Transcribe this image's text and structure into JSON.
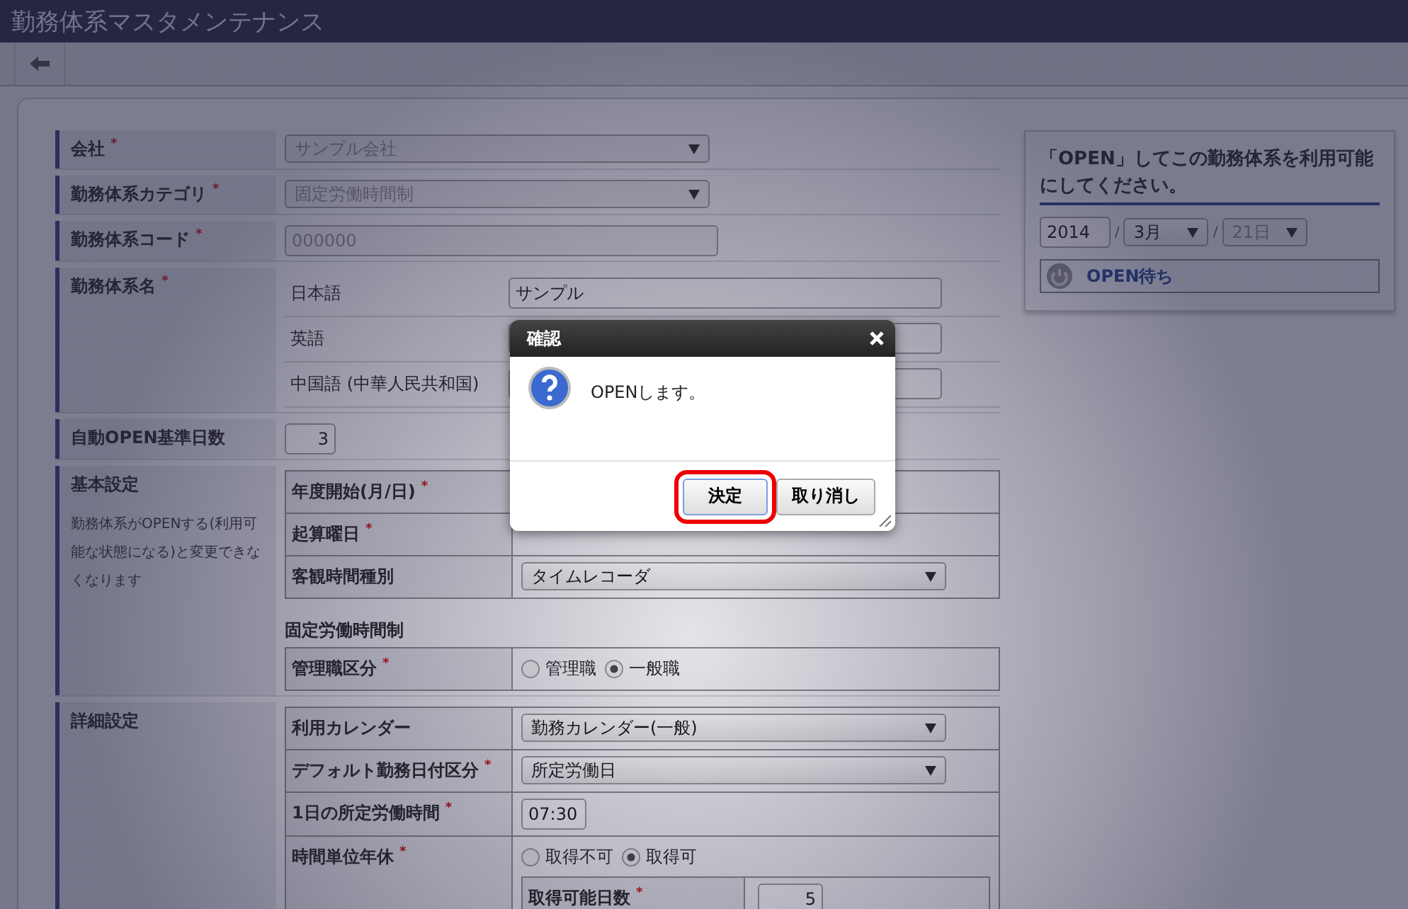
{
  "window": {
    "title": "勤務体系マスタメンテナンス"
  },
  "form": {
    "rows": [
      {
        "kind": "select",
        "label": "会社",
        "mark": "*",
        "value": "サンプル会社",
        "disabled": true
      },
      {
        "kind": "select",
        "label": "勤務体系カテゴリ",
        "mark": "*",
        "value": "固定労働時間制",
        "disabled": true
      },
      {
        "kind": "input",
        "label": "勤務体系コード",
        "mark": "*",
        "value": "000000",
        "disabled": true
      },
      {
        "kind": "names",
        "label": "勤務体系名",
        "mark": "*",
        "names": [
          {
            "language": "日本語",
            "value": "サンプル"
          },
          {
            "language": "英語"
          },
          {
            "language": "中国語 (中華人民共和国)"
          }
        ]
      },
      {
        "kind": "number",
        "label": "自動OPEN基準日数",
        "value": "3",
        "disabled": false
      },
      {
        "kind": "section",
        "label": "基本設定",
        "note": "勤務体系がOPENする(利用可能な状態になる)と変更できなくなります",
        "groups": [
          {
            "fields": [
              {
                "kind": "blank",
                "label": "年度開始(月/日)",
                "mark": "*"
              },
              {
                "kind": "blank",
                "label": "起算曜日",
                "mark": "*"
              },
              {
                "kind": "select",
                "label": "客観時間種別",
                "value": "タイムレコーダ",
                "disabled": false
              }
            ]
          },
          {
            "heading": "固定労働時間制",
            "fields": [
              {
                "kind": "radio",
                "label": "管理職区分",
                "mark": "*",
                "options": [
                  {
                    "label": "管理職",
                    "selected": false
                  },
                  {
                    "label": "一般職",
                    "selected": true
                  }
                ]
              }
            ]
          }
        ]
      },
      {
        "kind": "section",
        "label": "詳細設定",
        "groups": [
          {
            "fields": [
              {
                "kind": "select",
                "label": "利用カレンダー",
                "value": "勤務カレンダー(一般)",
                "disabled": false
              },
              {
                "kind": "select",
                "label": "デフォルト勤務日付区分",
                "mark": "*",
                "value": "所定労働日",
                "disabled": false
              },
              {
                "kind": "input",
                "label": "1日の所定労働時間",
                "mark": "*",
                "value": "07:30",
                "disabled": false
              },
              {
                "kind": "radio",
                "label": "時間単位年休",
                "mark": "*",
                "options": [
                  {
                    "label": "取得不可",
                    "selected": false
                  },
                  {
                    "label": "取得可",
                    "selected": true
                  }
                ],
                "sub_fields": [
                  {
                    "kind": "number",
                    "label": "取得可能日数",
                    "mark": "*",
                    "value": "5",
                    "disabled": false
                  }
                ]
              }
            ]
          }
        ]
      }
    ]
  },
  "open_panel": {
    "message": "「OPEN」してこの勤務体系を利用可能にしてください。",
    "date": [
      {
        "kind": "input",
        "value": "2014",
        "disabled": false
      },
      {
        "kind": "select",
        "prefix": "/",
        "value": "3月",
        "disabled": false
      },
      {
        "kind": "select",
        "prefix": "/",
        "value": "21日",
        "disabled": true
      }
    ],
    "status": "OPEN待ち"
  },
  "dialog": {
    "title": "確認",
    "message": "OPENします。",
    "buttons": [
      {
        "label": "決定",
        "highlighted": true
      },
      {
        "label": "取り消し",
        "highlighted": false
      }
    ]
  }
}
